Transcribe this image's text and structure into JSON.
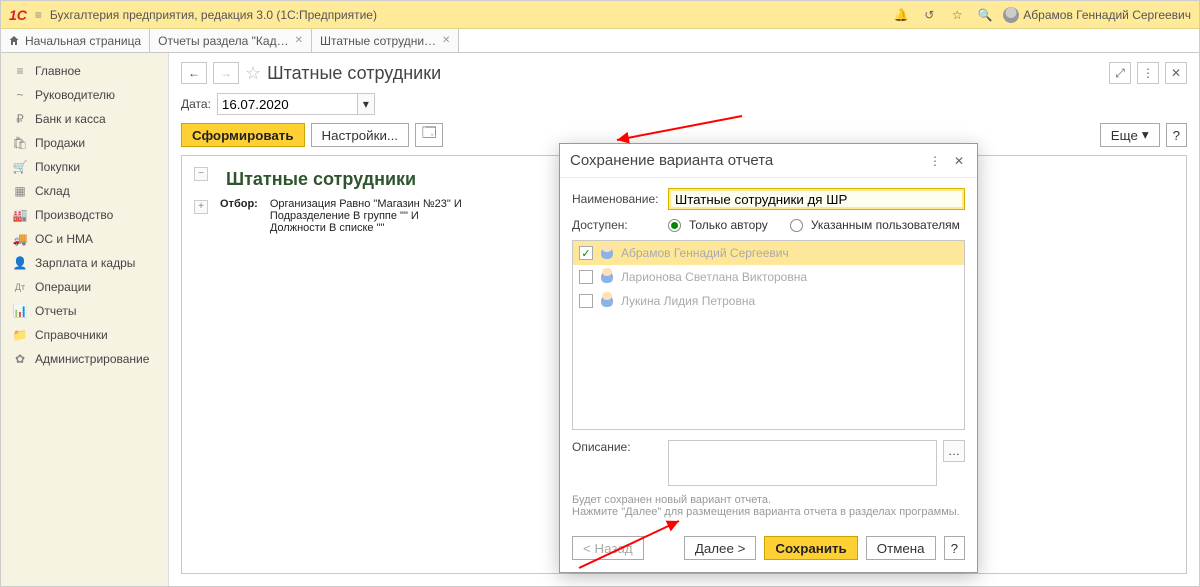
{
  "app": {
    "title": "Бухгалтерия предприятия, редакция 3.0  (1С:Предприятие)",
    "logo": "1C",
    "user": "Абрамов Геннадий Сергеевич"
  },
  "tabs": {
    "home": "Начальная страница",
    "t1": "Отчеты раздела \"Кад…",
    "t2": "Штатные сотрудни…"
  },
  "sidebar": [
    {
      "icon": "≡",
      "label": "Главное"
    },
    {
      "icon": "~",
      "label": "Руководителю"
    },
    {
      "icon": "₽",
      "label": "Банк и касса"
    },
    {
      "icon": "🛍",
      "label": "Продажи"
    },
    {
      "icon": "🛒",
      "label": "Покупки"
    },
    {
      "icon": "▦",
      "label": "Склад"
    },
    {
      "icon": "🏭",
      "label": "Производство"
    },
    {
      "icon": "🚚",
      "label": "ОС и НМА"
    },
    {
      "icon": "👤",
      "label": "Зарплата и кадры"
    },
    {
      "icon": "Дт",
      "label": "Операции"
    },
    {
      "icon": "📊",
      "label": "Отчеты"
    },
    {
      "icon": "📁",
      "label": "Справочники"
    },
    {
      "icon": "✿",
      "label": "Администрирование"
    }
  ],
  "page": {
    "title": "Штатные сотрудники",
    "date_label": "Дата:",
    "date": "16.07.2020",
    "generate": "Сформировать",
    "settings": "Настройки...",
    "more": "Еще",
    "report_title": "Штатные сотрудники",
    "filter_label": "Отбор:",
    "filter_text": "Организация Равно \"Магазин №23\" И\nПодразделение В группе \"\" И\nДолжности В списке \"\""
  },
  "modal": {
    "title": "Сохранение варианта отчета",
    "name_label": "Наименование:",
    "name_value": "Штатные сотрудники дя ШР",
    "access_label": "Доступен:",
    "access_author": "Только автору",
    "access_users": "Указанным пользователям",
    "users": [
      {
        "checked": true,
        "name": "Абрамов Геннадий Сергеевич",
        "sel": true
      },
      {
        "checked": false,
        "name": "Ларионова Светлана Викторовна",
        "sel": false
      },
      {
        "checked": false,
        "name": "Лукина Лидия Петровна",
        "sel": false
      }
    ],
    "desc_label": "Описание:",
    "hint1": "Будет сохранен новый вариант отчета.",
    "hint2": "Нажмите \"Далее\" для размещения варианта отчета в разделах программы.",
    "back": "< Назад",
    "next": "Далее >",
    "save": "Сохранить",
    "cancel": "Отмена",
    "help": "?"
  }
}
